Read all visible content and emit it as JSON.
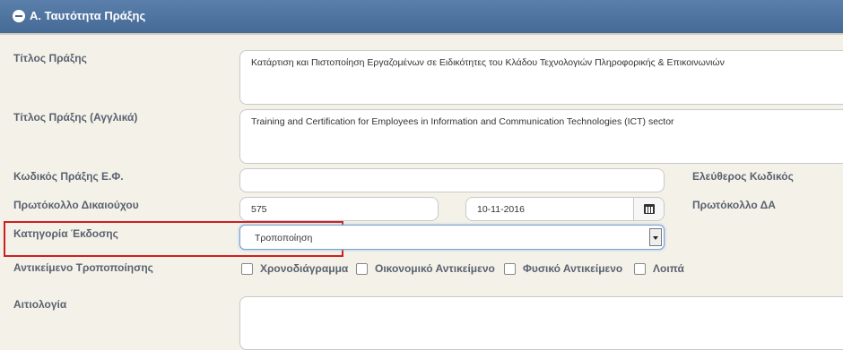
{
  "section": {
    "title": "Α. Ταυτότητα Πράξης"
  },
  "labels": {
    "title": "Τίτλος Πράξης",
    "title_en": "Τίτλος Πράξης (Αγγλικά)",
    "code": "Κωδικός Πράξης Ε.Φ.",
    "free_code": "Ελεύθερος Κωδικός",
    "protocol": "Πρωτόκολλο Δικαιούχου",
    "protocol_da": "Πρωτόκολλο ΔΑ",
    "category": "Κατηγορία Έκδοσης",
    "amend_subject": "Αντικείμενο Τροποποίησης",
    "justification": "Αιτιολογία"
  },
  "fields": {
    "title": "Κατάρτιση και Πιστοποίηση Εργαζομένων σε Ειδικότητες του Κλάδου Τεχνολογιών Πληροφορικής & Επικοινωνιών",
    "title_en": "Training and Certification for Employees in Information and Communication Technologies (ICT) sector",
    "code": "",
    "protocol_number": "575",
    "protocol_date": "10-11-2016",
    "category_selected": "Τροποποίηση",
    "justification": ""
  },
  "checkboxes": [
    {
      "label": "Χρονοδιάγραμμα",
      "checked": false
    },
    {
      "label": "Οικονομικό Αντικείμενο",
      "checked": false
    },
    {
      "label": "Φυσικό Αντικείμενο",
      "checked": false
    },
    {
      "label": "Λοιπά",
      "checked": false
    }
  ],
  "icons": {
    "collapse": "minus-circle-icon",
    "calendar": "calendar-icon",
    "dropdown": "chevron-down-icon"
  },
  "colors": {
    "header": "#4f74a0",
    "highlight": "#cc2020",
    "background": "#f4f1e8"
  }
}
